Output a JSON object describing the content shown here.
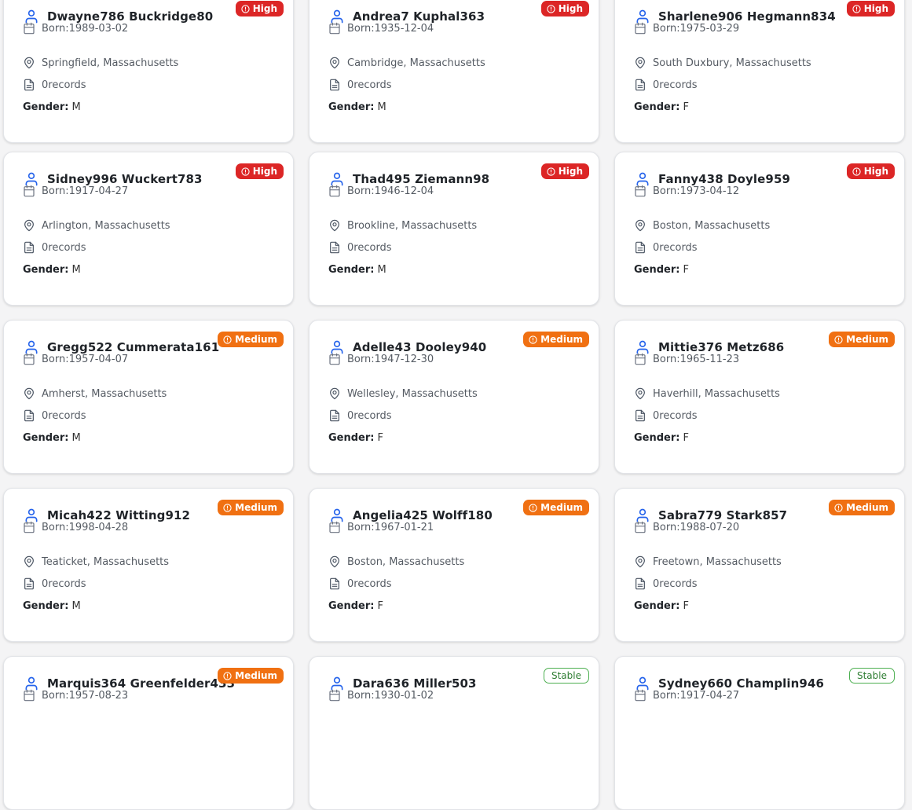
{
  "labels": {
    "born_prefix": "Born: ",
    "records_suffix": " records",
    "gender_label": "Gender:"
  },
  "colors": {
    "high": "#dc2626",
    "medium": "#f07012",
    "stable": "#4caf50",
    "person_icon": "#2563eb"
  },
  "patients": [
    {
      "name": "Dwayne786 Buckridge80",
      "born": "1989-03-02",
      "location": "Springfield, Massachusetts",
      "records": "0",
      "gender": "M",
      "priority": "High",
      "priority_level": "high"
    },
    {
      "name": "Andrea7 Kuphal363",
      "born": "1935-12-04",
      "location": "Cambridge, Massachusetts",
      "records": "0",
      "gender": "M",
      "priority": "High",
      "priority_level": "high"
    },
    {
      "name": "Sharlene906 Hegmann834",
      "born": "1975-03-29",
      "location": "South Duxbury, Massachusetts",
      "records": "0",
      "gender": "F",
      "priority": "High",
      "priority_level": "high"
    },
    {
      "name": "Sidney996 Wuckert783",
      "born": "1917-04-27",
      "location": "Arlington, Massachusetts",
      "records": "0",
      "gender": "M",
      "priority": "High",
      "priority_level": "high"
    },
    {
      "name": "Thad495 Ziemann98",
      "born": "1946-12-04",
      "location": "Brookline, Massachusetts",
      "records": "0",
      "gender": "M",
      "priority": "High",
      "priority_level": "high"
    },
    {
      "name": "Fanny438 Doyle959",
      "born": "1973-04-12",
      "location": "Boston, Massachusetts",
      "records": "0",
      "gender": "F",
      "priority": "High",
      "priority_level": "high"
    },
    {
      "name": "Gregg522 Cummerata161",
      "born": "1957-04-07",
      "location": "Amherst, Massachusetts",
      "records": "0",
      "gender": "M",
      "priority": "Medium",
      "priority_level": "medium"
    },
    {
      "name": "Adelle43 Dooley940",
      "born": "1947-12-30",
      "location": "Wellesley, Massachusetts",
      "records": "0",
      "gender": "F",
      "priority": "Medium",
      "priority_level": "medium"
    },
    {
      "name": "Mittie376 Metz686",
      "born": "1965-11-23",
      "location": "Haverhill, Massachusetts",
      "records": "0",
      "gender": "F",
      "priority": "Medium",
      "priority_level": "medium"
    },
    {
      "name": "Micah422 Witting912",
      "born": "1998-04-28",
      "location": "Teaticket, Massachusetts",
      "records": "0",
      "gender": "M",
      "priority": "Medium",
      "priority_level": "medium"
    },
    {
      "name": "Angelia425 Wolff180",
      "born": "1967-01-21",
      "location": "Boston, Massachusetts",
      "records": "0",
      "gender": "F",
      "priority": "Medium",
      "priority_level": "medium"
    },
    {
      "name": "Sabra779 Stark857",
      "born": "1988-07-20",
      "location": "Freetown, Massachusetts",
      "records": "0",
      "gender": "F",
      "priority": "Medium",
      "priority_level": "medium"
    },
    {
      "name": "Marquis364 Greenfelder433",
      "born": "1957-08-23",
      "location": "",
      "records": "",
      "gender": "",
      "priority": "Medium",
      "priority_level": "medium"
    },
    {
      "name": "Dara636 Miller503",
      "born": "1930-01-02",
      "location": "",
      "records": "",
      "gender": "",
      "priority": "Stable",
      "priority_level": "stable"
    },
    {
      "name": "Sydney660 Champlin946",
      "born": "1917-04-27",
      "location": "",
      "records": "",
      "gender": "",
      "priority": "Stable",
      "priority_level": "stable"
    }
  ]
}
